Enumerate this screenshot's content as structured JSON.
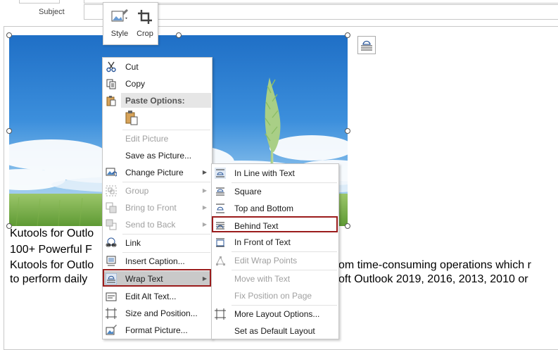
{
  "header": {
    "subject_label": "Subject"
  },
  "mini_toolbar": {
    "style_label": "Style",
    "crop_label": "Crop"
  },
  "document": {
    "lines": [
      "Kutools for Outlo",
      "100+ Powerful F",
      "Kutools for Outlo",
      "to perform daily",
      "om time-consuming operations which r",
      "oft Outlook 2019, 2016, 2013, 2010 or"
    ]
  },
  "context_menu": {
    "cut": "Cut",
    "copy": "Copy",
    "paste_options": "Paste Options:",
    "edit_picture": "Edit Picture",
    "save_as_picture": "Save as Picture...",
    "change_picture": "Change Picture",
    "group": "Group",
    "bring_to_front": "Bring to Front",
    "send_to_back": "Send to Back",
    "link": "Link",
    "insert_caption": "Insert Caption...",
    "wrap_text": "Wrap Text",
    "edit_alt_text": "Edit Alt Text...",
    "size_and_position": "Size and Position...",
    "format_picture": "Format Picture..."
  },
  "wrap_submenu": {
    "in_line_with_text": "In Line with Text",
    "square": "Square",
    "top_and_bottom": "Top and Bottom",
    "behind_text": "Behind Text",
    "in_front_of_text": "In Front of Text",
    "edit_wrap_points": "Edit Wrap Points",
    "move_with_text": "Move with Text",
    "fix_position_on_page": "Fix Position on Page",
    "more_layout_options": "More Layout Options...",
    "set_as_default_layout": "Set as Default Layout"
  },
  "colors": {
    "highlight_border": "#9b1c1c",
    "menu_hover": "#c9c9c9",
    "accent_blue": "#2b579a"
  }
}
